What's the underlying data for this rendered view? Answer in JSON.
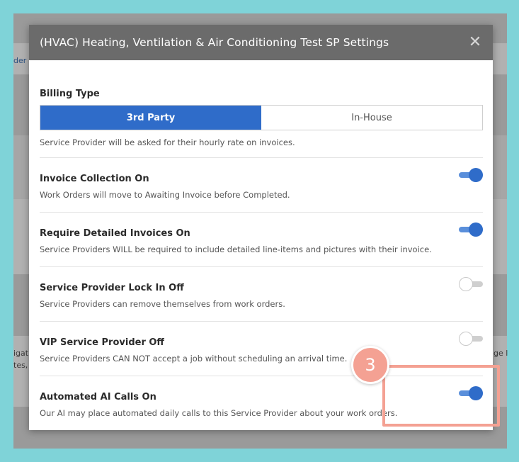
{
  "background": {
    "left_fragments": [
      "der",
      "igat",
      "tes,"
    ],
    "right_fragments": [
      "ge l"
    ]
  },
  "modal": {
    "title": "(HVAC) Heating, Ventilation & Air Conditioning Test SP Settings",
    "close_glyph": "✕",
    "billing": {
      "label": "Billing Type",
      "options": [
        "3rd Party",
        "In-House"
      ],
      "selected": "3rd Party",
      "description": "Service Provider will be asked for their hourly rate on invoices."
    },
    "settings": [
      {
        "label": "Invoice Collection On",
        "description": "Work Orders will move to Awaiting Invoice before Completed.",
        "state": "on"
      },
      {
        "label": "Require Detailed Invoices On",
        "description": "Service Providers WILL be required to include detailed line-items and pictures with their invoice.",
        "state": "on"
      },
      {
        "label": "Service Provider Lock In Off",
        "description": "Service Providers can remove themselves from work orders.",
        "state": "off"
      },
      {
        "label": "VIP Service Provider Off",
        "description": "Service Providers CAN NOT accept a job without scheduling an arrival time.",
        "state": "off"
      },
      {
        "label": "Automated AI Calls On",
        "description": "Our AI may place automated daily calls to this Service Provider about your work orders.",
        "state": "on"
      }
    ]
  },
  "annotation": {
    "step_number": "3",
    "accent_color": "#f4a193"
  },
  "colors": {
    "primary": "#2f6cc9",
    "header": "#6b6b6b",
    "backdrop": "#7fd3d8"
  }
}
